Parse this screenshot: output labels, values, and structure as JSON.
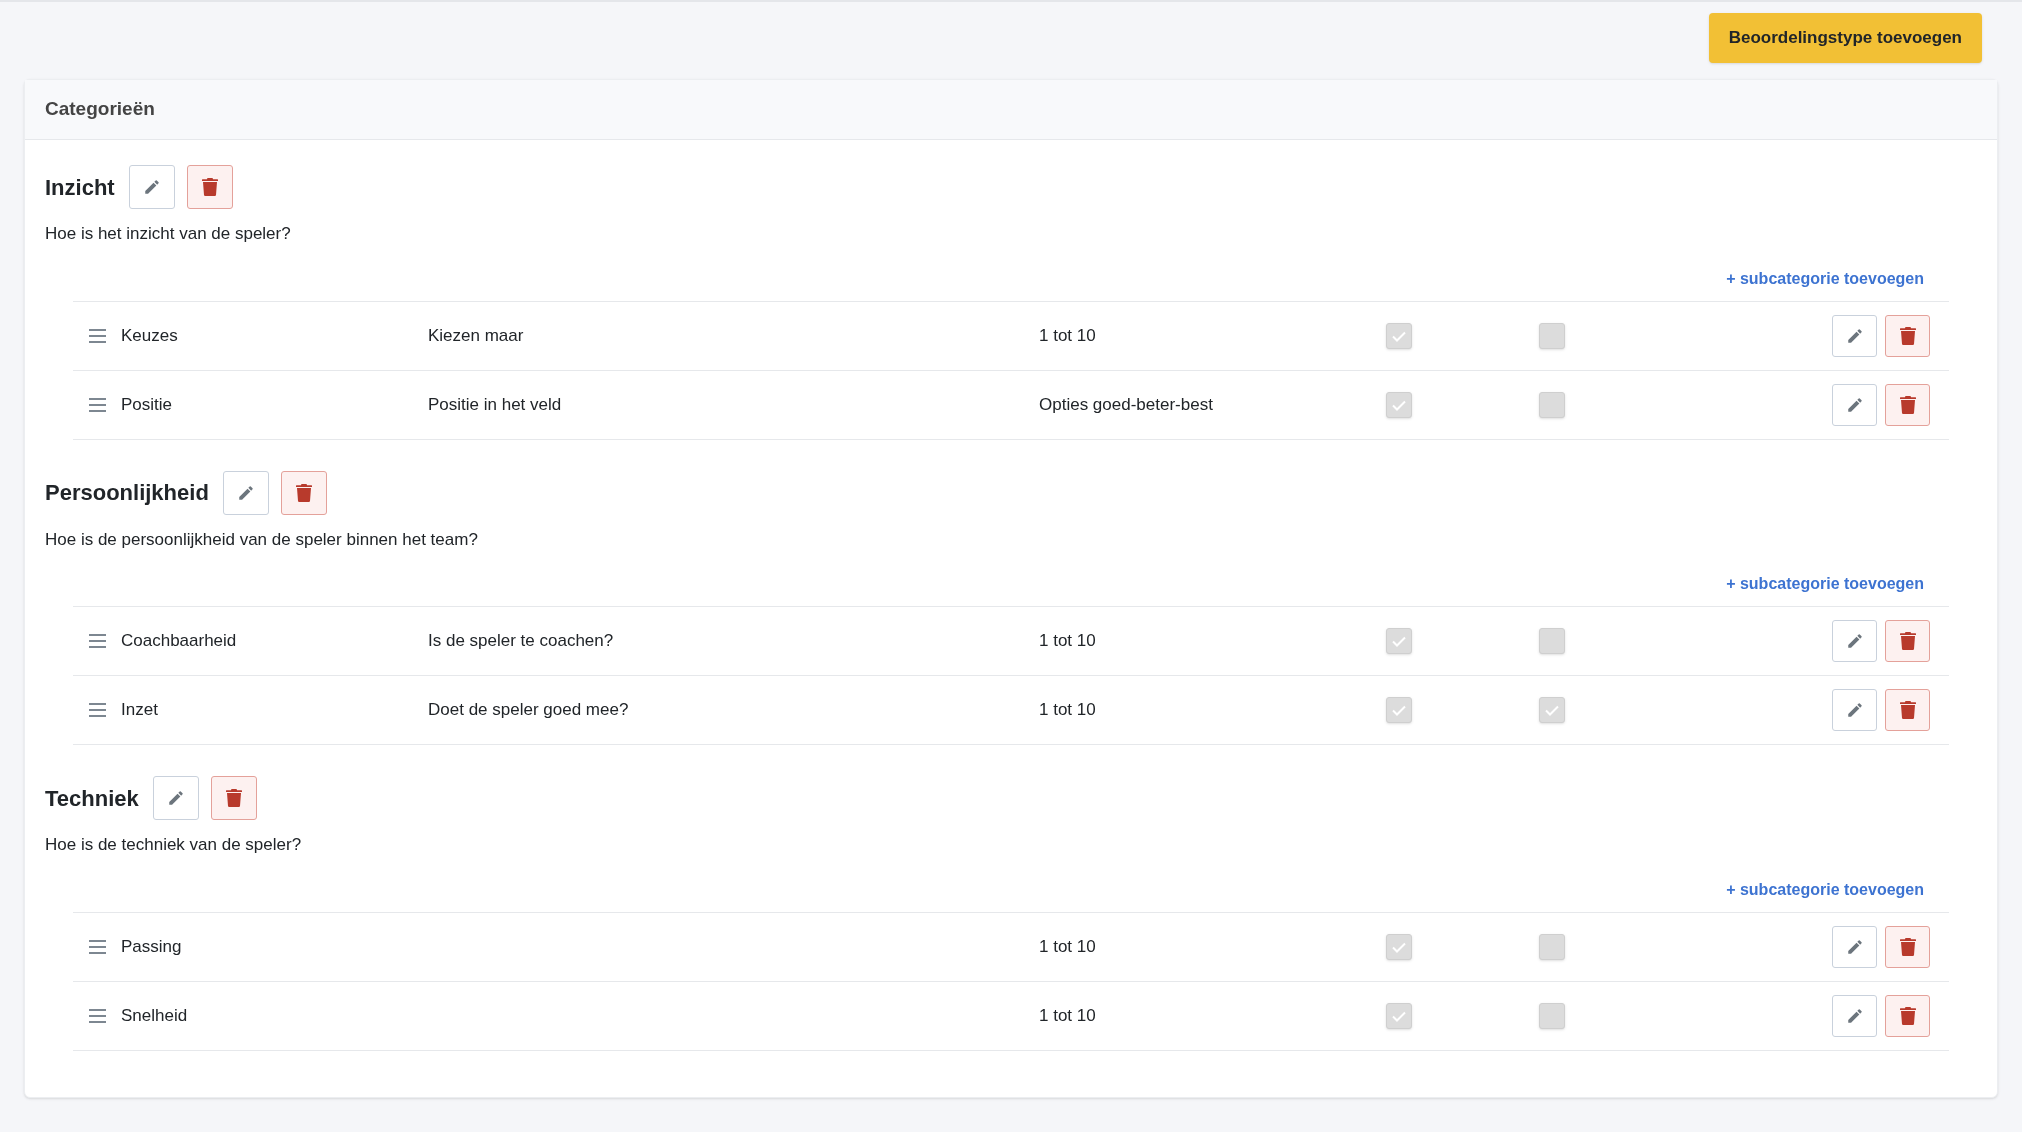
{
  "add_button": "Beoordelingstype toevoegen",
  "card": {
    "title": "Categorieën",
    "categories": [
      {
        "title": "Inzicht",
        "description": "Hoe is het inzicht van de speler?",
        "add_link": "+ subcategorie toevoegen",
        "rows": [
          {
            "name": "Keuzes",
            "description": "Kiezen maar",
            "type": "1 tot 10",
            "checkbox_1": true,
            "checkbox_2": false
          },
          {
            "name": "Positie",
            "description": "Positie in het veld",
            "type": "Opties goed-beter-best",
            "checkbox_1": true,
            "checkbox_2": false
          }
        ]
      },
      {
        "title": "Persoonlijkheid",
        "description": "Hoe is de persoonlijkheid van de speler binnen het team?",
        "add_link": "+ subcategorie toevoegen",
        "rows": [
          {
            "name": "Coachbaarheid",
            "description": "Is de speler te coachen?",
            "type": "1 tot 10",
            "checkbox_1": true,
            "checkbox_2": false
          },
          {
            "name": "Inzet",
            "description": "Doet de speler goed mee?",
            "type": "1 tot 10",
            "checkbox_1": true,
            "checkbox_2": true
          }
        ]
      },
      {
        "title": "Techniek",
        "description": "Hoe is de techniek van de speler?",
        "add_link": "+ subcategorie toevoegen",
        "rows": [
          {
            "name": "Passing",
            "type": "1 tot 10",
            "checkbox_1": true,
            "checkbox_2": false
          },
          {
            "name": "Snelheid",
            "type": "1 tot 10",
            "checkbox_1": true,
            "checkbox_2": false
          }
        ]
      }
    ]
  }
}
